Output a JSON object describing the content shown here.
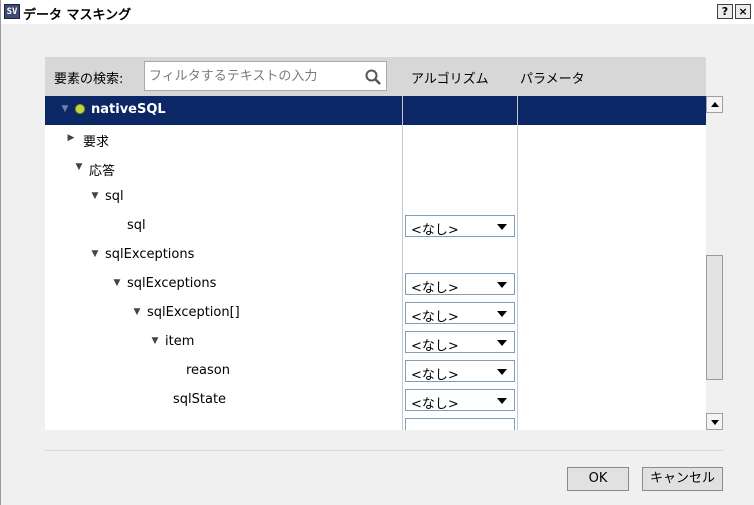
{
  "window": {
    "title": "データ マスキング",
    "app_icon_text": "SV",
    "help_label": "?",
    "close_label": "×"
  },
  "header": {
    "search_label": "要素の検索:",
    "search_placeholder": "フィルタするテキストの入力",
    "columns": [
      "アルゴリズム",
      "パラメータ"
    ]
  },
  "tree": {
    "rows": [
      {
        "label": "nativeSQL",
        "expander": "down",
        "selected": true,
        "icon": "node-icon",
        "algorithm": null
      },
      {
        "label": "要求",
        "expander": "right",
        "selected": false,
        "algorithm": null
      },
      {
        "label": "応答",
        "expander": "down",
        "selected": false,
        "algorithm": null
      },
      {
        "label": "sql",
        "expander": "down",
        "selected": false,
        "algorithm": null
      },
      {
        "label": "sql",
        "expander": null,
        "selected": false,
        "algorithm": "<なし>"
      },
      {
        "label": "sqlExceptions",
        "expander": "down",
        "selected": false,
        "algorithm": null
      },
      {
        "label": "sqlExceptions",
        "expander": "down",
        "selected": false,
        "algorithm": "<なし>"
      },
      {
        "label": "sqlException[]",
        "expander": "down",
        "selected": false,
        "algorithm": "<なし>"
      },
      {
        "label": "item",
        "expander": "down",
        "selected": false,
        "algorithm": "<なし>"
      },
      {
        "label": "reason",
        "expander": null,
        "selected": false,
        "algorithm": "<なし>"
      },
      {
        "label": "sqlState",
        "expander": null,
        "selected": false,
        "algorithm": "<なし>"
      }
    ]
  },
  "buttons": {
    "ok": "OK",
    "cancel": "キャンセル"
  },
  "colors": {
    "selection": "#0b2766",
    "node_icon": "#c6d63a",
    "header_bg": "#d7d7d7"
  }
}
